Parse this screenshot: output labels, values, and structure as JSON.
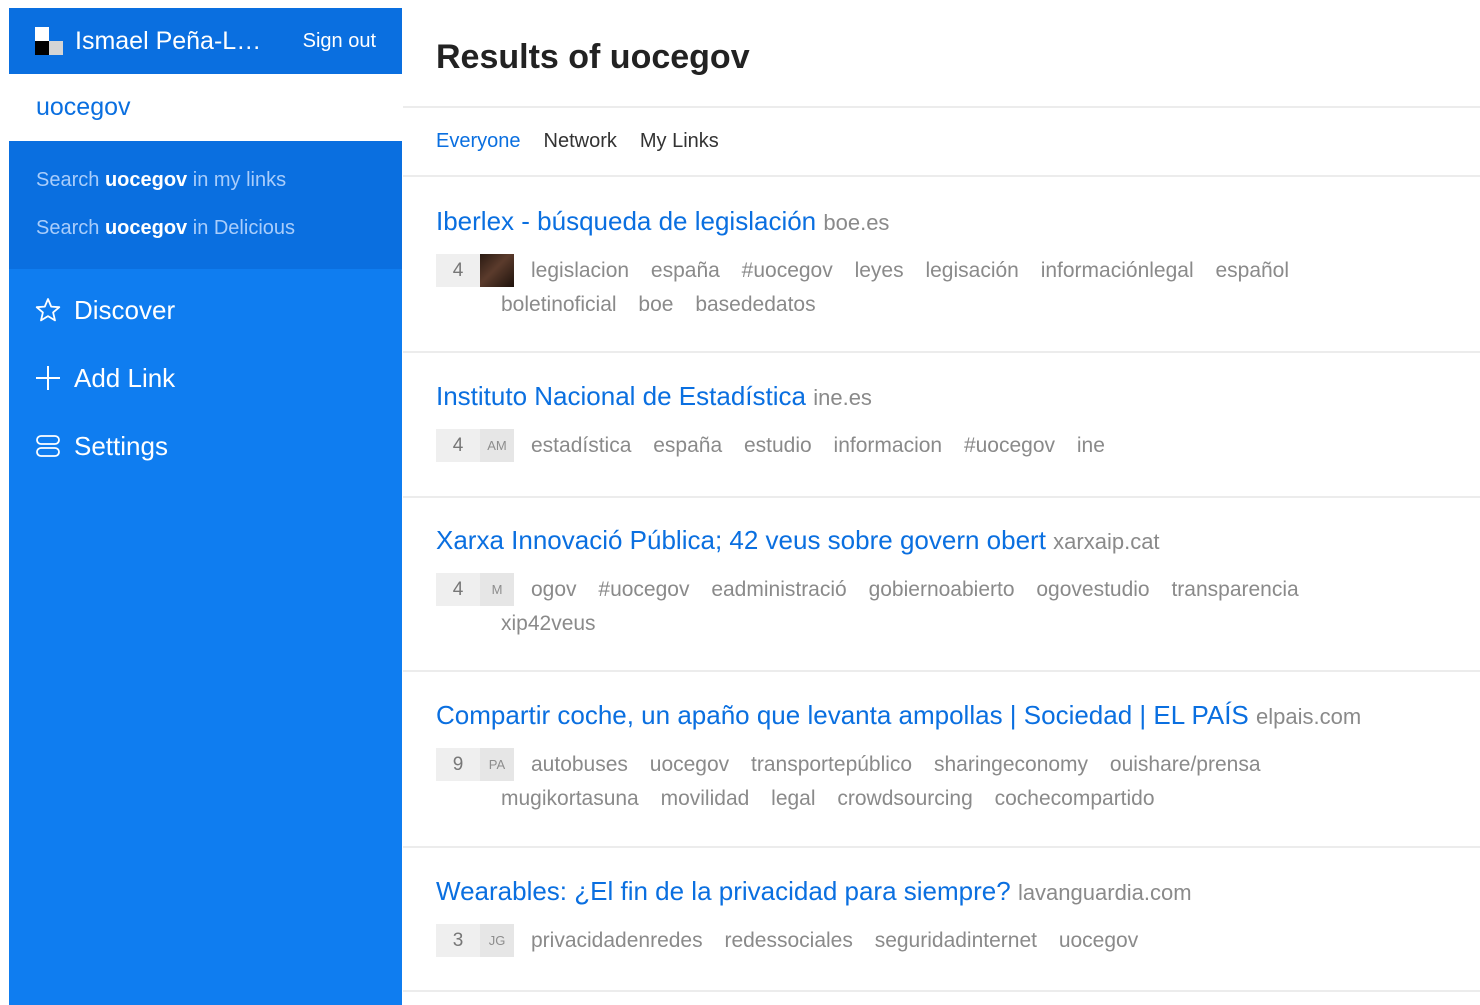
{
  "user": {
    "name": "Ismael Peña-López",
    "sign_out_label": "Sign out"
  },
  "search": {
    "query": "uocegov"
  },
  "suggestions": [
    {
      "prefix": "Search ",
      "term": "uocegov",
      "suffix": " in my links"
    },
    {
      "prefix": "Search ",
      "term": "uocegov",
      "suffix": " in Delicious"
    }
  ],
  "nav": [
    {
      "label": "Discover",
      "icon": "star-icon"
    },
    {
      "label": "Add Link",
      "icon": "plus-icon"
    },
    {
      "label": "Settings",
      "icon": "settings-icon"
    }
  ],
  "main": {
    "title": "Results of uocegov",
    "tabs": [
      "Everyone",
      "Network",
      "My Links"
    ],
    "active_tab": "Everyone"
  },
  "results": [
    {
      "title": "Iberlex - búsqueda de legislación",
      "domain": "boe.es",
      "count": "4",
      "avatar": "",
      "tags": [
        "legislacion",
        "españa",
        "#uocegov",
        "leyes",
        "legisación",
        "informaciónlegal",
        "español",
        "boletinoficial",
        "boe",
        "basededatos"
      ]
    },
    {
      "title": "Instituto Nacional de Estadística",
      "domain": "ine.es",
      "count": "4",
      "avatar": "AM",
      "tags": [
        "estadística",
        "españa",
        "estudio",
        "informacion",
        "#uocegov",
        "ine"
      ]
    },
    {
      "title": "Xarxa Innovació Pública; 42 veus sobre govern obert",
      "domain": "xarxaip.cat",
      "count": "4",
      "avatar": "M",
      "tags": [
        "ogov",
        "#uocegov",
        "eadministració",
        "gobiernoabierto",
        "ogovestudio",
        "transparencia",
        "xip42veus"
      ]
    },
    {
      "title": "Compartir coche, un apaño que levanta ampollas | Sociedad | EL PAÍS",
      "domain": "elpais.com",
      "count": "9",
      "avatar": "PA",
      "tags": [
        "autobuses",
        "uocegov",
        "transportepúblico",
        "sharingeconomy",
        "ouishare/prensa",
        "mugikortasuna",
        "movilidad",
        "legal",
        "crowdsourcing",
        "cochecompartido"
      ]
    },
    {
      "title": "Wearables: ¿El fin de la privacidad para siempre?",
      "domain": "lavanguardia.com",
      "count": "3",
      "avatar": "JG",
      "tags": [
        "privacidadenredes",
        "redessociales",
        "seguridadinternet",
        "uocegov"
      ]
    }
  ],
  "colors": {
    "brand_blue": "#0f7df0",
    "dark_blue": "#0a6fe0",
    "tag_gray": "#8a8a8a"
  }
}
